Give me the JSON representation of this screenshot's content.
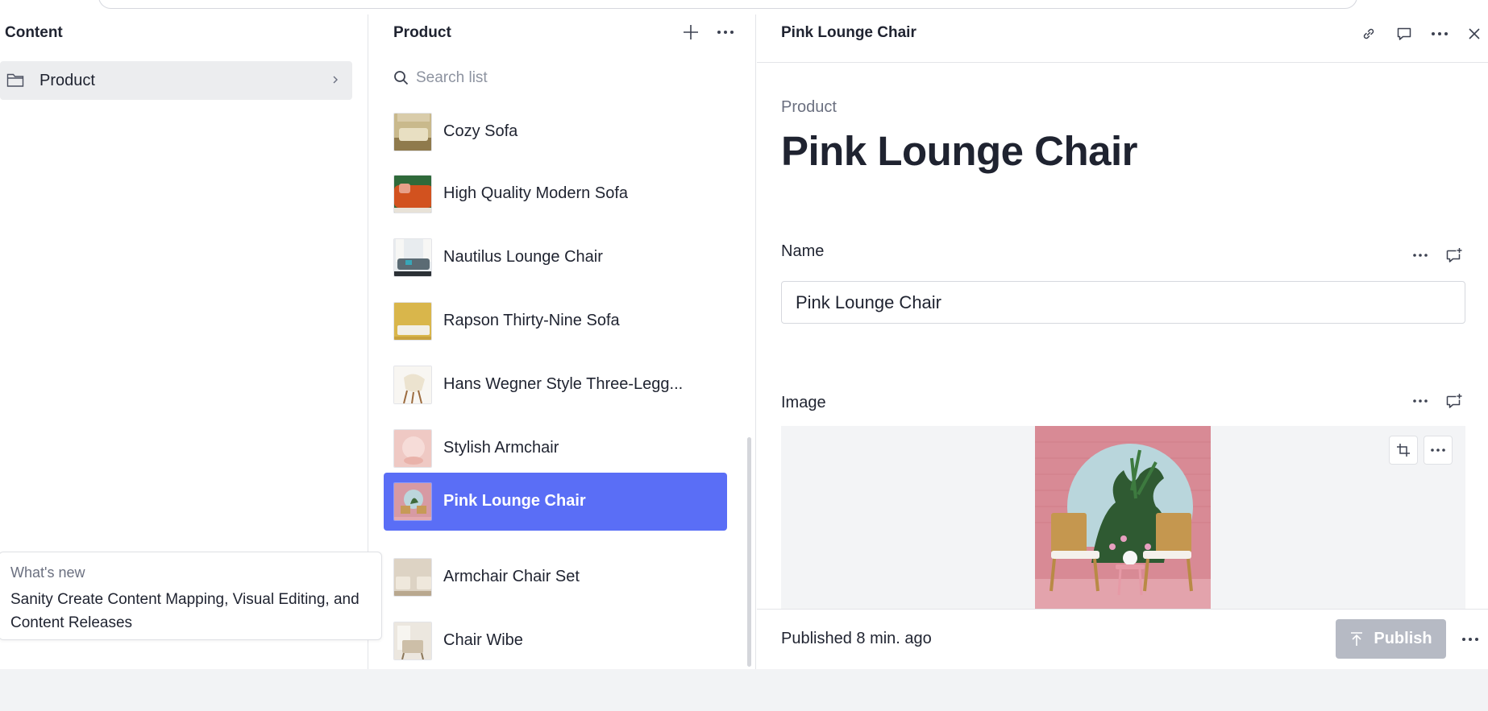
{
  "content_pane": {
    "title": "Content",
    "items": [
      {
        "label": "Product",
        "icon": "folder-icon"
      }
    ]
  },
  "whats_new": {
    "kicker": "What's new",
    "message": "Sanity Create Content Mapping, Visual Editing, and Content Releases"
  },
  "list_pane": {
    "title": "Product",
    "search_placeholder": "Search list",
    "items": [
      {
        "name": "Cozy Sofa"
      },
      {
        "name": "High Quality Modern Sofa"
      },
      {
        "name": "Nautilus Lounge Chair"
      },
      {
        "name": "Rapson Thirty-Nine Sofa"
      },
      {
        "name": "Hans Wegner Style Three-Legg..."
      },
      {
        "name": "Stylish Armchair"
      },
      {
        "name": "Pink Lounge Chair",
        "selected": true
      },
      {
        "name": "Armchair Chair Set"
      },
      {
        "name": "Chair Wibe"
      }
    ]
  },
  "document": {
    "header_title": "Pink Lounge Chair",
    "type_label": "Product",
    "heading": "Pink Lounge Chair",
    "fields": {
      "name_label": "Name",
      "name_value": "Pink Lounge Chair",
      "image_label": "Image"
    },
    "footer": {
      "status": "Published 8 min. ago",
      "publish_label": "Publish"
    }
  },
  "colors": {
    "accent": "#5a6ef6",
    "publish_disabled": "#b6bac4",
    "text": "#1f2330",
    "muted": "#6b7080"
  }
}
